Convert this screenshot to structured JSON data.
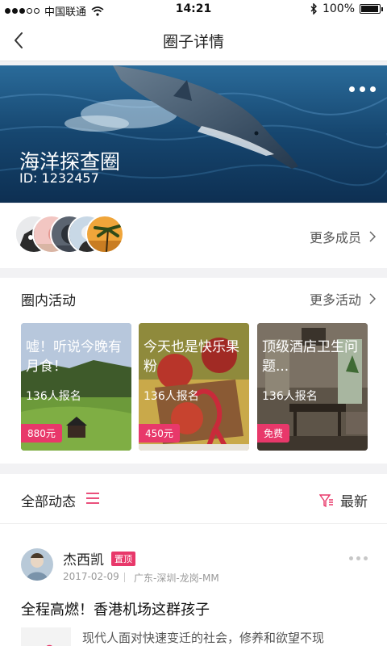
{
  "status_bar": {
    "carrier": "中国联通",
    "time": "14:21",
    "battery": "100%",
    "battery_level": 1.0
  },
  "nav": {
    "title": "圈子详情",
    "back_icon": "chevron-left-icon"
  },
  "circle": {
    "name": "海洋探查圈",
    "id_text": "ID: 1232457",
    "more_icon": "more-horizontal-icon"
  },
  "members": {
    "more_label": "更多成员"
  },
  "activities": {
    "heading": "圈内活动",
    "more_label": "更多活动",
    "items": [
      {
        "title": "嘘！听说今晚有月食！",
        "count": "136人报名",
        "price": "880元"
      },
      {
        "title": "今天也是快乐果粉",
        "count": "136人报名",
        "price": "450元"
      },
      {
        "title": "顶级酒店卫生问题...",
        "count": "136人报名",
        "price": "免费"
      }
    ]
  },
  "feed": {
    "heading": "全部动态",
    "sort_label": "最新",
    "post": {
      "author": "杰西凯",
      "badge": "置顶",
      "date": "2017-02-09",
      "location": "广东-深圳-龙岗-MM",
      "title": "全程高燃！香港机场这群孩子",
      "excerpt": "现代人面对快速变迁的社会，修养和欲望不现"
    }
  },
  "colors": {
    "accent": "#e8386a",
    "ocean": "#1d4f7a"
  }
}
